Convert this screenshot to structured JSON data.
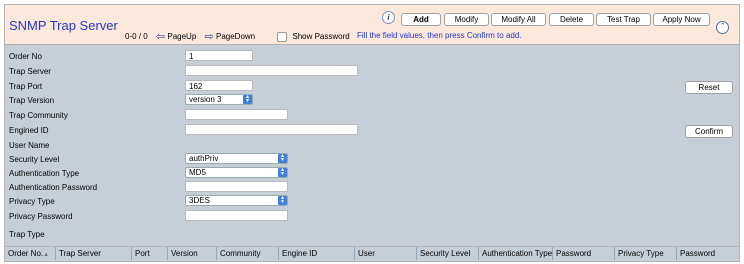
{
  "header": {
    "title": "SNMP Trap Server",
    "counter": "0-0 / 0",
    "page_up": "PageUp",
    "page_down": "PageDown",
    "show_password": "Show Password",
    "hint": "Fill the field values, then press Confirm to add."
  },
  "toolbar": {
    "add": "Add",
    "modify": "Modify",
    "modify_all": "Modify All",
    "delete": "Delete",
    "test_trap": "Test Trap",
    "apply_now": "Apply Now"
  },
  "form": {
    "order_no": {
      "label": "Order No",
      "value": "1"
    },
    "trap_server": {
      "label": "Trap Server",
      "value": ""
    },
    "trap_port": {
      "label": "Trap Port",
      "value": "162"
    },
    "trap_version": {
      "label": "Trap Version",
      "value": "version 3"
    },
    "trap_community": {
      "label": "Trap Community",
      "value": ""
    },
    "engined_id": {
      "label": "Engined ID",
      "value": ""
    },
    "user_name": {
      "label": "User Name"
    },
    "security_level": {
      "label": "Security Level",
      "value": "authPriv"
    },
    "auth_type": {
      "label": "Authentication Type",
      "value": "MD5"
    },
    "auth_password": {
      "label": "Authentication Password",
      "value": ""
    },
    "privacy_type": {
      "label": "Privacy Type",
      "value": "3DES"
    },
    "privacy_password": {
      "label": "Privacy Password",
      "value": ""
    },
    "trap_type": {
      "label": "Trap Type"
    }
  },
  "side_buttons": {
    "reset": "Reset",
    "confirm": "Confirm"
  },
  "table": {
    "columns": [
      "Order No.",
      "Trap Server",
      "Port",
      "Version",
      "Community",
      "Engine ID",
      "User",
      "Security Level",
      "Authentication Type",
      "Password",
      "Privacy Type",
      "Password"
    ]
  }
}
